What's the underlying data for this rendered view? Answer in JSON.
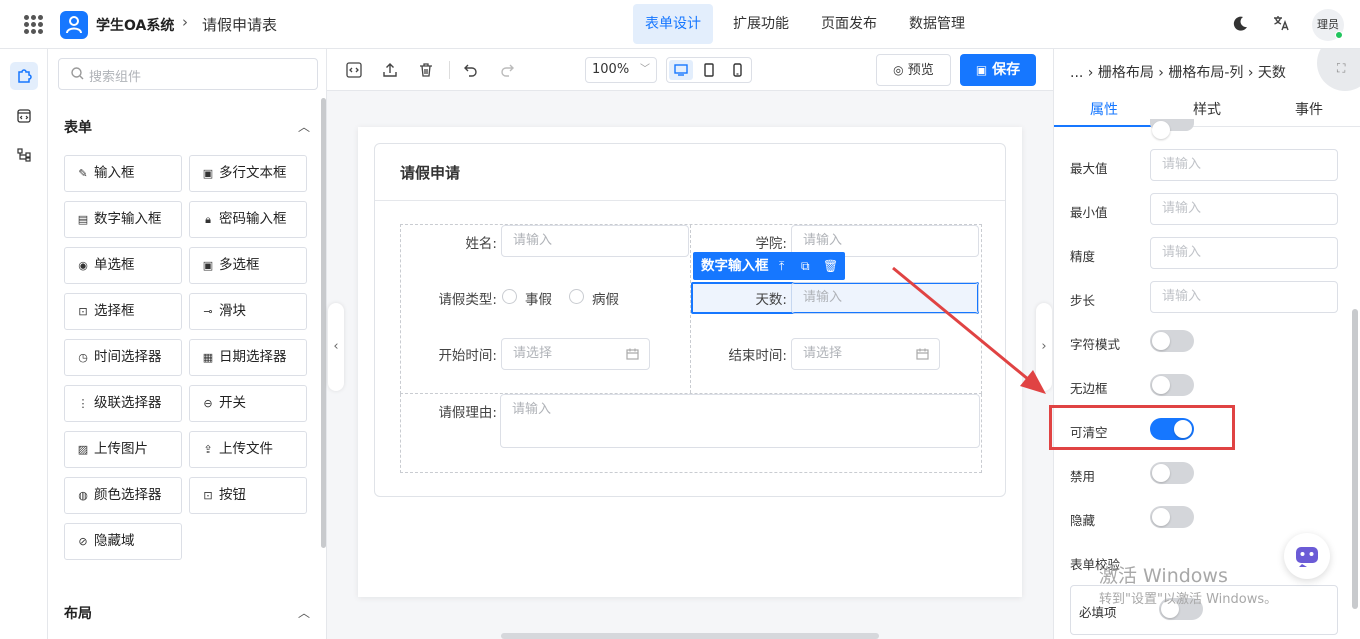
{
  "header": {
    "app_title": "学生OA系统",
    "crumb_sep": "›",
    "page_title": "请假申请表",
    "nav": [
      "表单设计",
      "扩展功能",
      "页面发布",
      "数据管理"
    ],
    "lang_icon": "translate-icon",
    "avatar_text": "理员"
  },
  "components": {
    "search_placeholder": "搜索组件",
    "group_form": "表单",
    "items": [
      {
        "label": "输入框",
        "icon": "✎"
      },
      {
        "label": "多行文本框",
        "icon": "▣"
      },
      {
        "label": "数字输入框",
        "icon": "▤"
      },
      {
        "label": "密码输入框",
        "icon": "🔒︎"
      },
      {
        "label": "单选框",
        "icon": "◉"
      },
      {
        "label": "多选框",
        "icon": "▣"
      },
      {
        "label": "选择框",
        "icon": "⊡"
      },
      {
        "label": "滑块",
        "icon": "⊸"
      },
      {
        "label": "时间选择器",
        "icon": "◷"
      },
      {
        "label": "日期选择器",
        "icon": "▦"
      },
      {
        "label": "级联选择器",
        "icon": "⋮"
      },
      {
        "label": "开关",
        "icon": "⊖"
      },
      {
        "label": "上传图片",
        "icon": "▨"
      },
      {
        "label": "上传文件",
        "icon": "⇪"
      },
      {
        "label": "颜色选择器",
        "icon": "◍"
      },
      {
        "label": "按钮",
        "icon": "⊡"
      },
      {
        "label": "隐藏域",
        "icon": "⊘"
      }
    ],
    "group_layout": "布局"
  },
  "toolbar": {
    "zoom": "100%",
    "preview_label": "预览",
    "save_label": "保存"
  },
  "form": {
    "title": "请假申请",
    "name_label": "姓名:",
    "name_placeholder": "请输入",
    "college_label": "学院:",
    "college_placeholder": "请输入",
    "type_label": "请假类型:",
    "type_options": [
      "事假",
      "病假"
    ],
    "days_label": "天数:",
    "days_placeholder": "请输入",
    "start_label": "开始时间:",
    "start_placeholder": "请选择",
    "end_label": "结束时间:",
    "end_placeholder": "请选择",
    "reason_label": "请假理由:",
    "reason_placeholder": "请输入",
    "selected_tag": "数字输入框"
  },
  "props": {
    "breadcrumb": "... › 栅格布局 › 栅格布局-列 › 天数",
    "tabs": [
      "属性",
      "样式",
      "事件"
    ],
    "max_label": "最大值",
    "min_label": "最小值",
    "precision_label": "精度",
    "step_label": "步长",
    "input_placeholder": "请输入",
    "char_mode_label": "字符模式",
    "no_border_label": "无边框",
    "clearable_label": "可清空",
    "disabled_label": "禁用",
    "hidden_label": "隐藏",
    "validation_label": "表单校验",
    "required_label": "必填项",
    "switches": {
      "char_mode": false,
      "no_border": false,
      "clearable": true,
      "disabled": false,
      "hidden": false,
      "required": false
    }
  },
  "watermark": {
    "line1": "激活 Windows",
    "line2": "转到\"设置\"以激活 Windows。"
  },
  "colors": {
    "accent": "#1677ff",
    "highlight": "#e04343"
  }
}
